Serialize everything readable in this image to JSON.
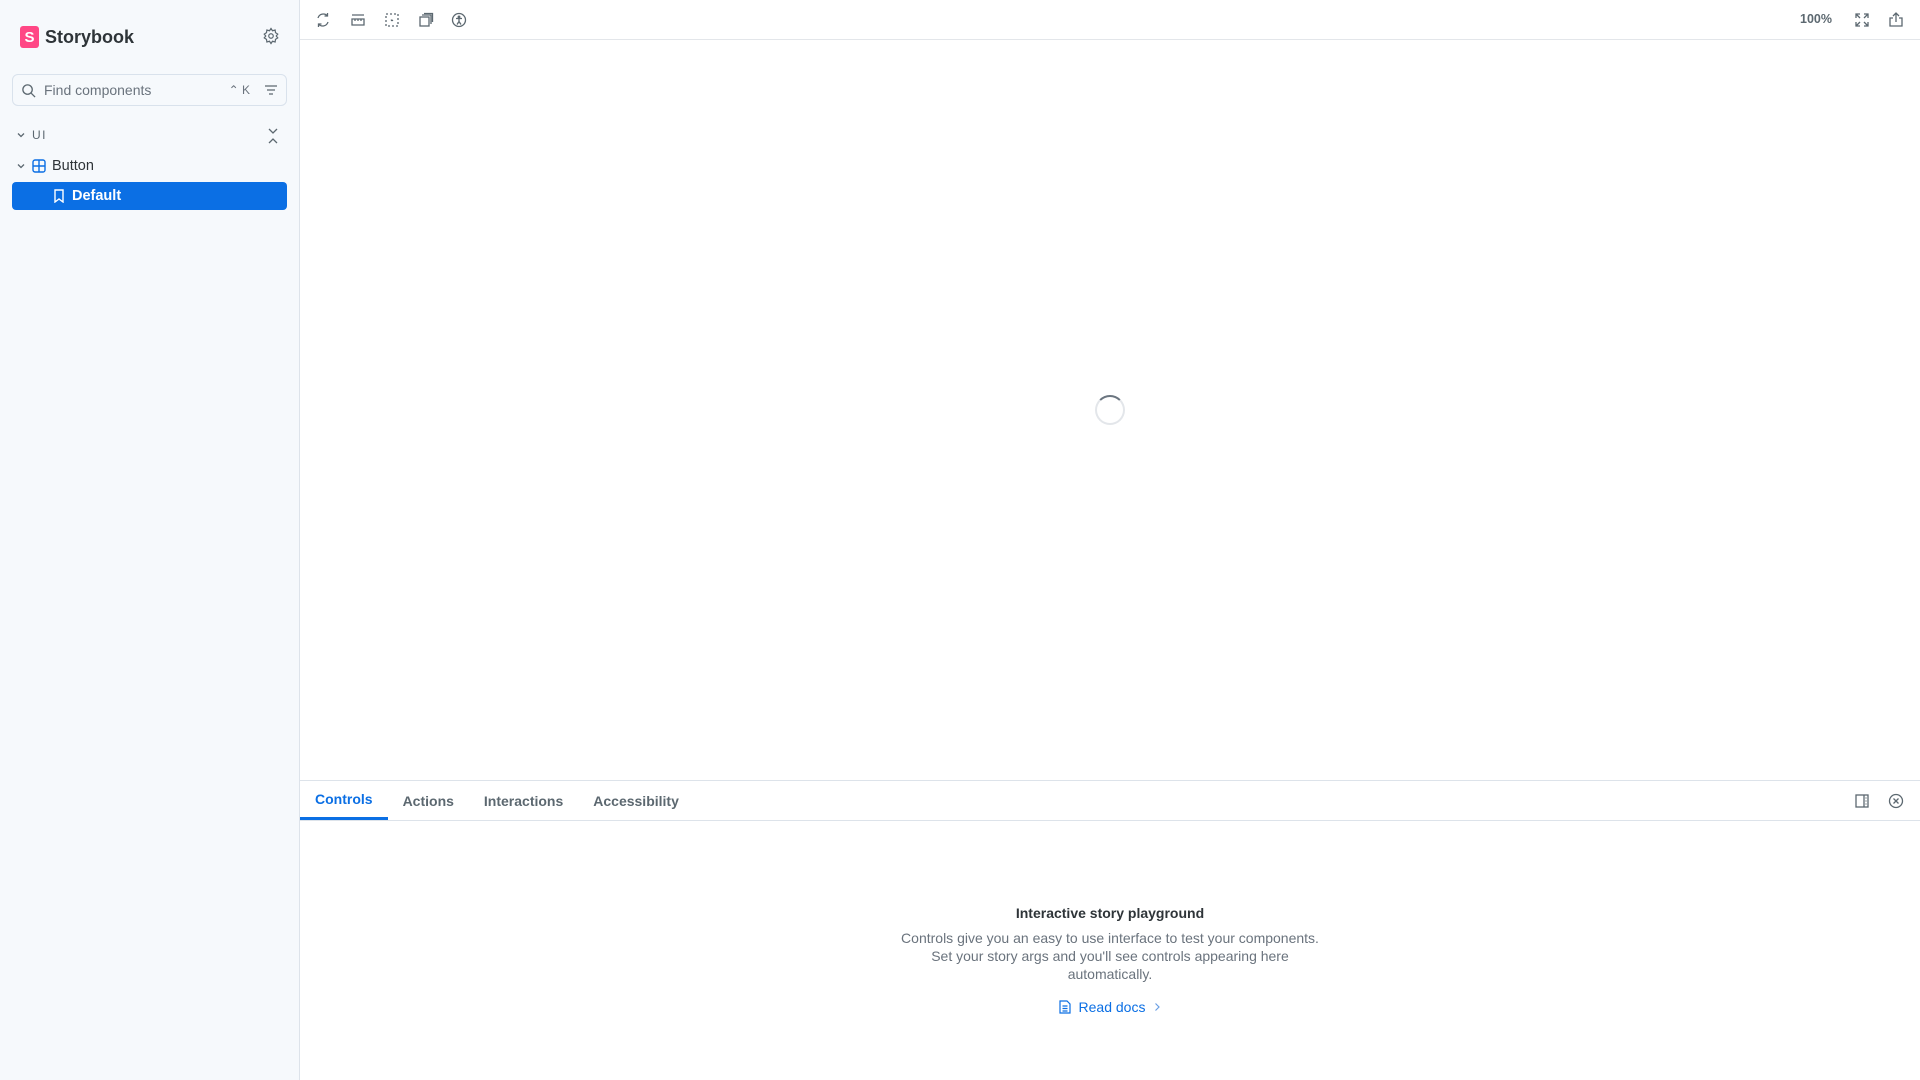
{
  "sidebar": {
    "brand": "Storybook",
    "search": {
      "placeholder": "Find components",
      "shortcut": "⌃ K"
    },
    "group": "UI",
    "component": "Button",
    "story": "Default"
  },
  "toolbar": {
    "zoom": "100%"
  },
  "panel": {
    "tabs": [
      {
        "label": "Controls"
      },
      {
        "label": "Actions"
      },
      {
        "label": "Interactions"
      },
      {
        "label": "Accessibility"
      }
    ],
    "empty": {
      "title": "Interactive story playground",
      "body": "Controls give you an easy to use interface to test your components. Set your story args and you'll see controls appearing here automatically.",
      "link": "Read docs"
    }
  },
  "colors": {
    "accent": "#0b6fe4",
    "brand": "#ff4785"
  }
}
